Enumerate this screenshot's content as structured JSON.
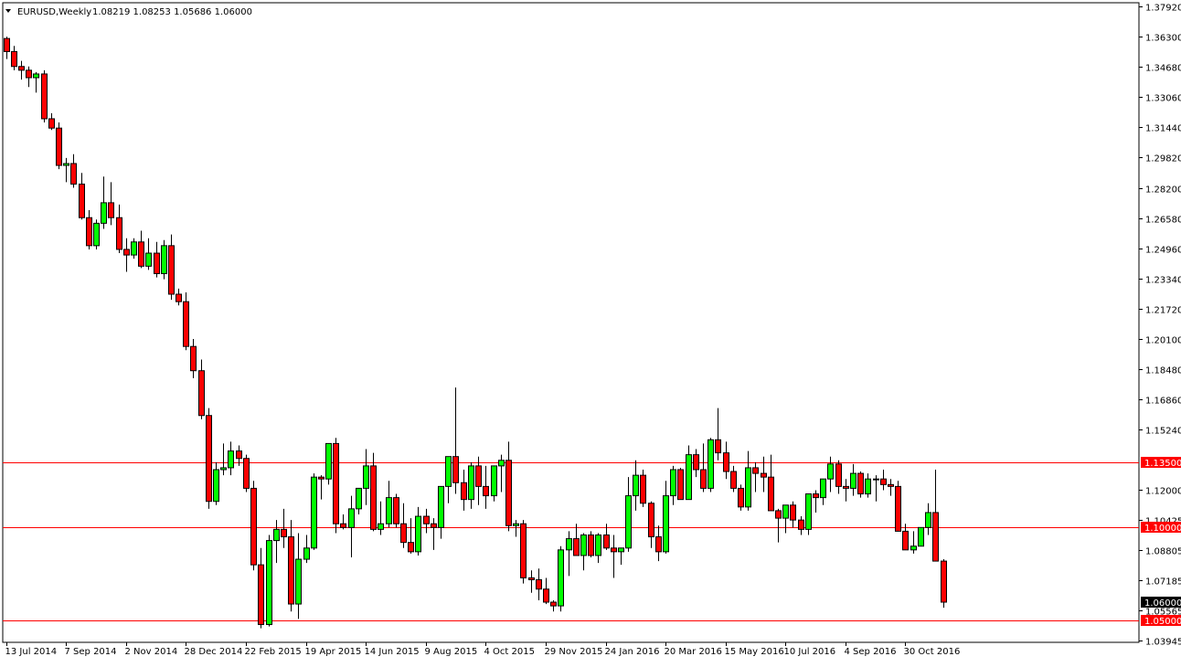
{
  "chart_data": {
    "type": "candlestick",
    "symbol": "EURUSD",
    "timeframe": "Weekly",
    "title": "EURUSD,Weekly",
    "ohlc_text": "1.08219 1.08253 1.05686 1.06000",
    "ylim": [
      1.03945,
      1.3792
    ],
    "y_ticks": [
      1.3792,
      1.363,
      1.3468,
      1.3306,
      1.3144,
      1.2982,
      1.282,
      1.2658,
      1.2496,
      1.2334,
      1.2172,
      1.201,
      1.1848,
      1.1686,
      1.1524,
      1.12,
      1.10425,
      1.08805,
      1.07185,
      1.05565,
      1.03945
    ],
    "y_tick_labels": [
      "1.37920",
      "1.36300",
      "1.34680",
      "1.33060",
      "1.31440",
      "1.29820",
      "1.28200",
      "1.26580",
      "1.24960",
      "1.23340",
      "1.21720",
      "1.20100",
      "1.18480",
      "1.16860",
      "1.15240",
      "1.12000",
      "1.10425",
      "1.08805",
      "1.07185",
      "1.05565",
      "1.03945"
    ],
    "x_labels": [
      "13 Jul 2014",
      "7 Sep 2014",
      "2 Nov 2014",
      "28 Dec 2014",
      "22 Feb 2015",
      "19 Apr 2015",
      "14 Jun 2015",
      "9 Aug 2015",
      "4 Oct 2015",
      "29 Nov 2015",
      "24 Jan 2016",
      "20 Mar 2016",
      "15 May 2016",
      "10 Jul 2016",
      "4 Sep 2016",
      "30 Oct 2016"
    ],
    "x_label_bar_index": [
      0,
      8,
      16,
      24,
      32,
      40,
      48,
      56,
      64,
      72,
      80,
      88,
      96,
      104,
      112,
      120
    ],
    "bars": [
      [
        1.362,
        1.363,
        1.351,
        1.355
      ],
      [
        1.355,
        1.358,
        1.345,
        1.347
      ],
      [
        1.347,
        1.35,
        1.34,
        1.345
      ],
      [
        1.345,
        1.347,
        1.336,
        1.341
      ],
      [
        1.341,
        1.344,
        1.333,
        1.343
      ],
      [
        1.343,
        1.345,
        1.317,
        1.319
      ],
      [
        1.319,
        1.322,
        1.313,
        1.314
      ],
      [
        1.314,
        1.317,
        1.292,
        1.294
      ],
      [
        1.294,
        1.298,
        1.285,
        1.295
      ],
      [
        1.295,
        1.3,
        1.282,
        1.284
      ],
      [
        1.284,
        1.29,
        1.265,
        1.266
      ],
      [
        1.266,
        1.27,
        1.249,
        1.251
      ],
      [
        1.251,
        1.265,
        1.249,
        1.263
      ],
      [
        1.263,
        1.288,
        1.26,
        1.274
      ],
      [
        1.274,
        1.285,
        1.262,
        1.266
      ],
      [
        1.266,
        1.273,
        1.247,
        1.249
      ],
      [
        1.249,
        1.255,
        1.237,
        1.246
      ],
      [
        1.246,
        1.255,
        1.244,
        1.253
      ],
      [
        1.253,
        1.259,
        1.239,
        1.24
      ],
      [
        1.24,
        1.255,
        1.238,
        1.247
      ],
      [
        1.247,
        1.253,
        1.234,
        1.236
      ],
      [
        1.236,
        1.254,
        1.233,
        1.251
      ],
      [
        1.251,
        1.257,
        1.222,
        1.225
      ],
      [
        1.225,
        1.228,
        1.219,
        1.221
      ],
      [
        1.221,
        1.226,
        1.195,
        1.197
      ],
      [
        1.197,
        1.201,
        1.18,
        1.184
      ],
      [
        1.184,
        1.19,
        1.158,
        1.16
      ],
      [
        1.16,
        1.164,
        1.11,
        1.114
      ],
      [
        1.114,
        1.135,
        1.112,
        1.131
      ],
      [
        1.131,
        1.145,
        1.128,
        1.132
      ],
      [
        1.132,
        1.146,
        1.128,
        1.141
      ],
      [
        1.141,
        1.144,
        1.133,
        1.137
      ],
      [
        1.137,
        1.139,
        1.119,
        1.121
      ],
      [
        1.121,
        1.125,
        1.077,
        1.08
      ],
      [
        1.08,
        1.089,
        1.046,
        1.048
      ],
      [
        1.048,
        1.096,
        1.047,
        1.093
      ],
      [
        1.093,
        1.104,
        1.081,
        1.099
      ],
      [
        1.099,
        1.11,
        1.089,
        1.095
      ],
      [
        1.095,
        1.104,
        1.055,
        1.059
      ],
      [
        1.059,
        1.097,
        1.051,
        1.083
      ],
      [
        1.083,
        1.096,
        1.081,
        1.089
      ],
      [
        1.089,
        1.129,
        1.088,
        1.127
      ],
      [
        1.127,
        1.128,
        1.115,
        1.126
      ],
      [
        1.126,
        1.144,
        1.123,
        1.145
      ],
      [
        1.145,
        1.148,
        1.097,
        1.102
      ],
      [
        1.102,
        1.107,
        1.099,
        1.1
      ],
      [
        1.1,
        1.117,
        1.084,
        1.11
      ],
      [
        1.11,
        1.12,
        1.107,
        1.121
      ],
      [
        1.121,
        1.142,
        1.112,
        1.133
      ],
      [
        1.133,
        1.14,
        1.098,
        1.099
      ],
      [
        1.099,
        1.114,
        1.096,
        1.102
      ],
      [
        1.102,
        1.125,
        1.1,
        1.116
      ],
      [
        1.116,
        1.118,
        1.1,
        1.102
      ],
      [
        1.102,
        1.113,
        1.089,
        1.092
      ],
      [
        1.092,
        1.105,
        1.086,
        1.087
      ],
      [
        1.087,
        1.111,
        1.085,
        1.106
      ],
      [
        1.106,
        1.11,
        1.097,
        1.102
      ],
      [
        1.102,
        1.105,
        1.088,
        1.1
      ],
      [
        1.1,
        1.12,
        1.094,
        1.122
      ],
      [
        1.122,
        1.137,
        1.113,
        1.138
      ],
      [
        1.138,
        1.175,
        1.118,
        1.124
      ],
      [
        1.124,
        1.131,
        1.109,
        1.115
      ],
      [
        1.115,
        1.135,
        1.11,
        1.133
      ],
      [
        1.133,
        1.138,
        1.112,
        1.122
      ],
      [
        1.122,
        1.133,
        1.11,
        1.117
      ],
      [
        1.117,
        1.128,
        1.114,
        1.133
      ],
      [
        1.133,
        1.139,
        1.119,
        1.136
      ],
      [
        1.136,
        1.146,
        1.098,
        1.101
      ],
      [
        1.101,
        1.104,
        1.095,
        1.102
      ],
      [
        1.102,
        1.104,
        1.07,
        1.073
      ],
      [
        1.073,
        1.077,
        1.065,
        1.072
      ],
      [
        1.072,
        1.078,
        1.061,
        1.067
      ],
      [
        1.067,
        1.073,
        1.059,
        1.06
      ],
      [
        1.06,
        1.061,
        1.055,
        1.058
      ],
      [
        1.058,
        1.09,
        1.055,
        1.088
      ],
      [
        1.088,
        1.098,
        1.074,
        1.094
      ],
      [
        1.094,
        1.102,
        1.085,
        1.085
      ],
      [
        1.085,
        1.097,
        1.077,
        1.096
      ],
      [
        1.096,
        1.098,
        1.084,
        1.085
      ],
      [
        1.085,
        1.097,
        1.081,
        1.096
      ],
      [
        1.096,
        1.102,
        1.088,
        1.089
      ],
      [
        1.089,
        1.096,
        1.073,
        1.087
      ],
      [
        1.087,
        1.089,
        1.08,
        1.089
      ],
      [
        1.089,
        1.127,
        1.087,
        1.117
      ],
      [
        1.117,
        1.136,
        1.109,
        1.128
      ],
      [
        1.128,
        1.131,
        1.111,
        1.113
      ],
      [
        1.113,
        1.114,
        1.089,
        1.095
      ],
      [
        1.095,
        1.101,
        1.082,
        1.087
      ],
      [
        1.087,
        1.125,
        1.086,
        1.117
      ],
      [
        1.117,
        1.133,
        1.112,
        1.131
      ],
      [
        1.131,
        1.132,
        1.116,
        1.115
      ],
      [
        1.115,
        1.144,
        1.115,
        1.139
      ],
      [
        1.139,
        1.142,
        1.127,
        1.131
      ],
      [
        1.131,
        1.145,
        1.119,
        1.121
      ],
      [
        1.121,
        1.148,
        1.119,
        1.147
      ],
      [
        1.147,
        1.164,
        1.136,
        1.14
      ],
      [
        1.14,
        1.146,
        1.126,
        1.13
      ],
      [
        1.13,
        1.133,
        1.119,
        1.121
      ],
      [
        1.121,
        1.123,
        1.109,
        1.111
      ],
      [
        1.111,
        1.141,
        1.109,
        1.132
      ],
      [
        1.132,
        1.135,
        1.119,
        1.129
      ],
      [
        1.129,
        1.138,
        1.119,
        1.127
      ],
      [
        1.127,
        1.139,
        1.11,
        1.109
      ],
      [
        1.109,
        1.11,
        1.092,
        1.105
      ],
      [
        1.105,
        1.112,
        1.097,
        1.112
      ],
      [
        1.112,
        1.114,
        1.1,
        1.104
      ],
      [
        1.104,
        1.106,
        1.096,
        1.099
      ],
      [
        1.099,
        1.117,
        1.096,
        1.118
      ],
      [
        1.118,
        1.12,
        1.108,
        1.116
      ],
      [
        1.116,
        1.125,
        1.112,
        1.126
      ],
      [
        1.126,
        1.138,
        1.119,
        1.134
      ],
      [
        1.134,
        1.136,
        1.118,
        1.122
      ],
      [
        1.122,
        1.126,
        1.114,
        1.121
      ],
      [
        1.121,
        1.134,
        1.117,
        1.129
      ],
      [
        1.129,
        1.13,
        1.116,
        1.118
      ],
      [
        1.118,
        1.129,
        1.116,
        1.126
      ],
      [
        1.126,
        1.128,
        1.114,
        1.126
      ],
      [
        1.126,
        1.131,
        1.12,
        1.123
      ],
      [
        1.123,
        1.126,
        1.117,
        1.122
      ],
      [
        1.122,
        1.125,
        1.101,
        1.098
      ],
      [
        1.098,
        1.102,
        1.091,
        1.088
      ],
      [
        1.088,
        1.098,
        1.086,
        1.09
      ],
      [
        1.09,
        1.1,
        1.094,
        1.1
      ],
      [
        1.1,
        1.113,
        1.096,
        1.108
      ],
      [
        1.108,
        1.131,
        1.082,
        1.082
      ],
      [
        1.082,
        1.083,
        1.057,
        1.06
      ]
    ],
    "horizontal_lines": [
      {
        "value": 1.135,
        "label": "1.13500"
      },
      {
        "value": 1.1,
        "label": "1.10000"
      },
      {
        "value": 1.05,
        "label": "1.05000"
      }
    ],
    "current_price": {
      "value": 1.06,
      "label": "1.06000"
    },
    "up_color": "#00ff00",
    "down_color": "#ff0000",
    "level_line_color": "#ff0000",
    "grid": false
  }
}
